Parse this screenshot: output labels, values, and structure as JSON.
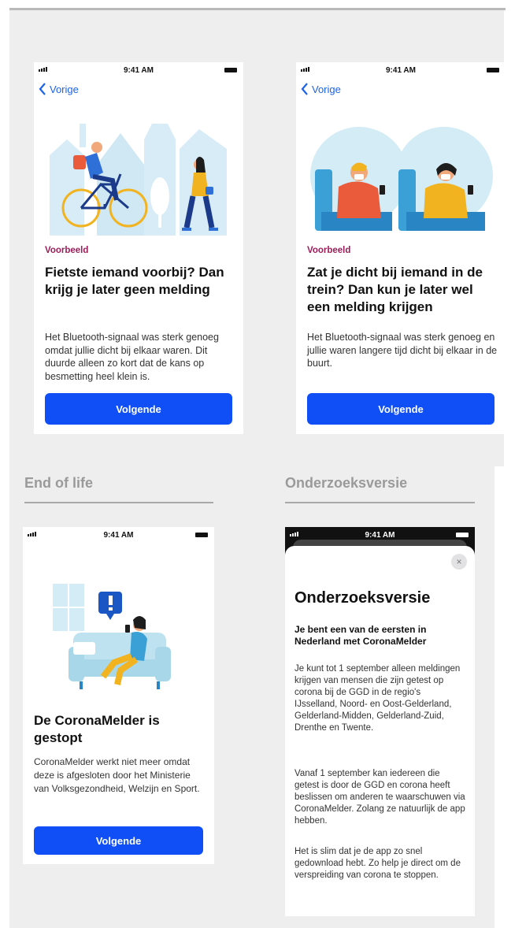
{
  "status": {
    "time": "9:41 AM"
  },
  "screens": {
    "bike": {
      "back_label": "Vorige",
      "tag": "Voorbeeld",
      "heading": "Fietste iemand voorbij? Dan krijg je later geen melding",
      "body": "Het Bluetooth-signaal was sterk genoeg omdat jullie dicht bij elkaar waren. Dit duurde alleen zo kort dat de kans op besmetting heel klein is.",
      "button": "Volgende"
    },
    "train": {
      "back_label": "Vorige",
      "tag": "Voorbeeld",
      "heading": "Zat je dicht bij iemand in de trein? Dan kun je later wel een melding krijgen",
      "body": "Het Bluetooth-signaal was sterk genoeg en jullie waren langere tijd dicht bij elkaar in de buurt.",
      "button": "Volgende"
    },
    "end_of_life": {
      "section": "End of life",
      "heading": "De CoronaMelder is gestopt",
      "body": "CoronaMelder werkt niet meer omdat deze is afgesloten door het Ministerie van Volksgezondheid, Welzijn en Sport.",
      "button": "Volgende"
    },
    "research": {
      "section": "Onderzoeksversie",
      "close": "×",
      "title": "Onderzoeksversie",
      "subtitle": "Je bent een van de eersten in Nederland met CoronaMelder",
      "p1": "Je kunt tot 1 september alleen meldingen krijgen van mensen die zijn getest op corona bij de GGD in de regio's IJsselland, Noord- en Oost-Gelderland, Gelderland-Midden, Gelderland-Zuid, Drenthe en Twente.",
      "p2": "Vanaf 1 september kan iedereen die getest is door de GGD en corona heeft beslissen om anderen te waarschuwen via CoronaMelder. Zolang ze natuurlijk de app hebben.",
      "p3": "Het is slim dat je de app zo snel gedownload hebt. Zo help je direct om de verspreiding van corona te stoppen."
    }
  },
  "colors": {
    "accent": "#0f4ff5",
    "tag": "#9b1d5a",
    "link": "#1c63e8"
  },
  "icons": [
    "signal-icon",
    "battery-icon",
    "chevron-left-icon",
    "close-icon",
    "bike-illustration",
    "train-illustration",
    "sofa-illustration"
  ]
}
